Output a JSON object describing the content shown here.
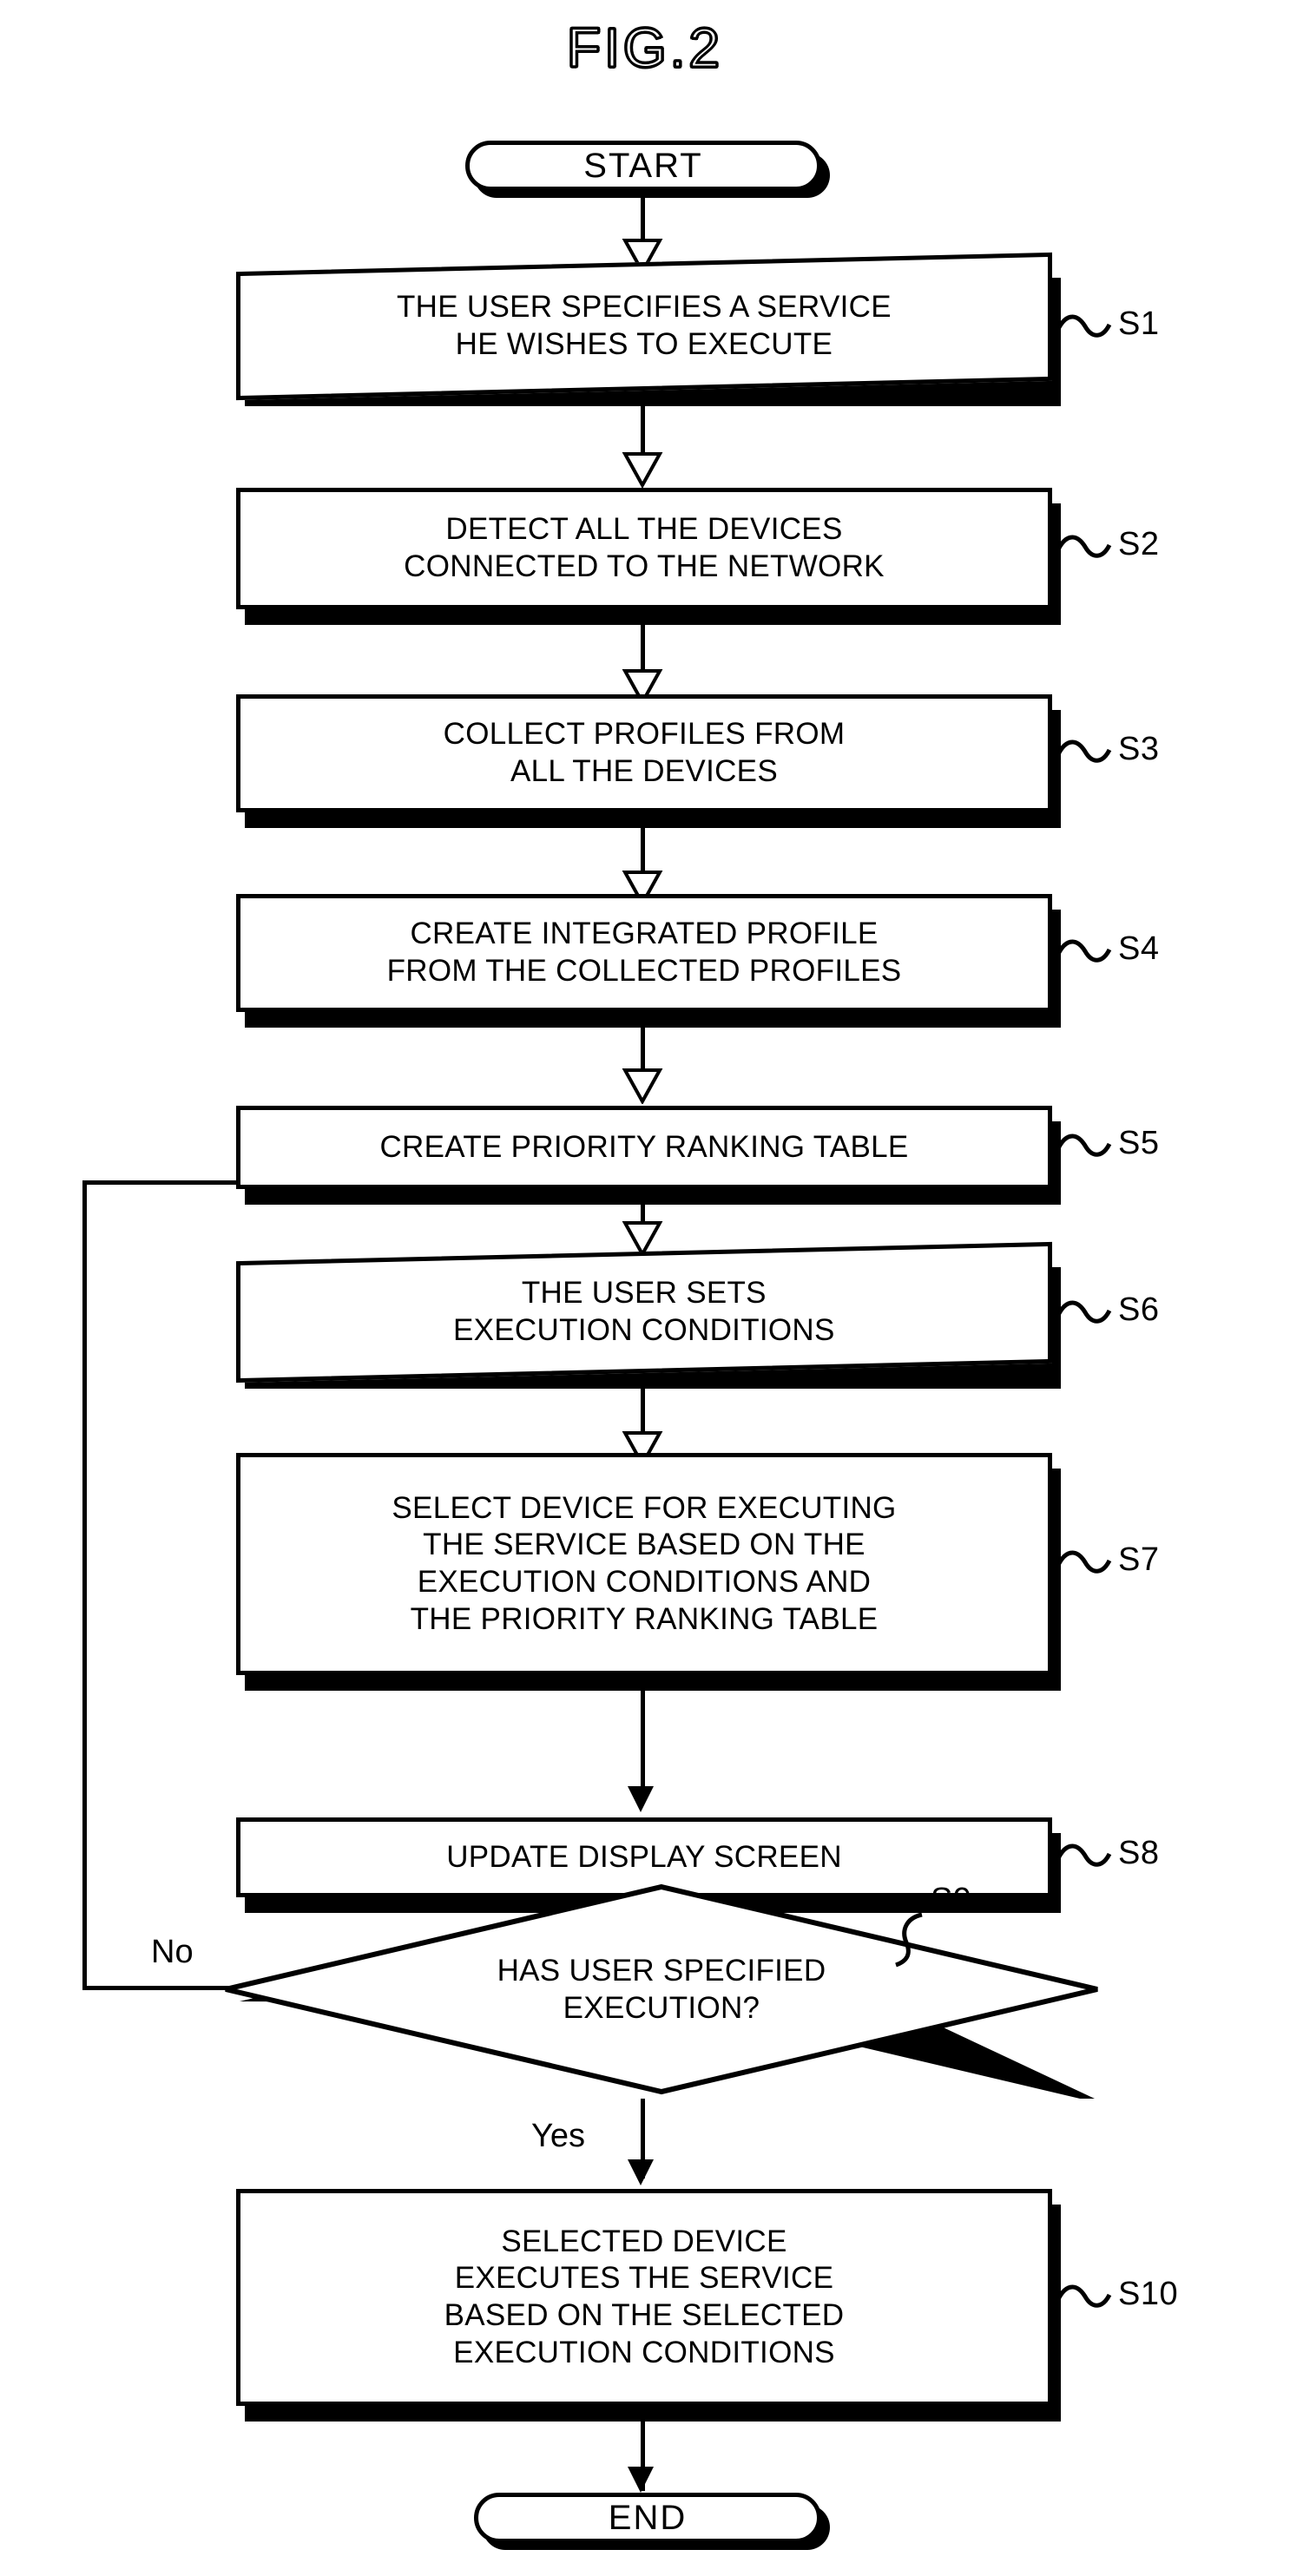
{
  "figure": {
    "title": "FIG.2"
  },
  "nodes": {
    "start": {
      "label": "START",
      "type": "terminator"
    },
    "end": {
      "label": "END",
      "type": "terminator"
    },
    "s1": {
      "ref": "S1",
      "text": "THE USER SPECIFIES A SERVICE\nHE WISHES TO EXECUTE"
    },
    "s2": {
      "ref": "S2",
      "text": "DETECT ALL THE DEVICES\nCONNECTED TO THE NETWORK"
    },
    "s3": {
      "ref": "S3",
      "text": "COLLECT PROFILES FROM\nALL THE DEVICES"
    },
    "s4": {
      "ref": "S4",
      "text": "CREATE INTEGRATED PROFILE\nFROM THE COLLECTED PROFILES"
    },
    "s5": {
      "ref": "S5",
      "text": "CREATE PRIORITY RANKING TABLE"
    },
    "s6": {
      "ref": "S6",
      "text": "THE USER SETS\nEXECUTION CONDITIONS"
    },
    "s7": {
      "ref": "S7",
      "text": "SELECT DEVICE FOR EXECUTING\nTHE SERVICE BASED ON THE\nEXECUTION CONDITIONS AND\nTHE PRIORITY RANKING TABLE"
    },
    "s8": {
      "ref": "S8",
      "text": "UPDATE DISPLAY SCREEN"
    },
    "s9": {
      "ref": "S9",
      "text": "HAS USER SPECIFIED\nEXECUTION?",
      "type": "decision"
    },
    "s10": {
      "ref": "S10",
      "text": "SELECTED DEVICE\nEXECUTES  THE SERVICE\nBASED ON THE SELECTED\nEXECUTION CONDITIONS"
    }
  },
  "branches": {
    "no": "No",
    "yes": "Yes"
  },
  "style": {
    "ink": "#000000",
    "paper": "#ffffff"
  }
}
